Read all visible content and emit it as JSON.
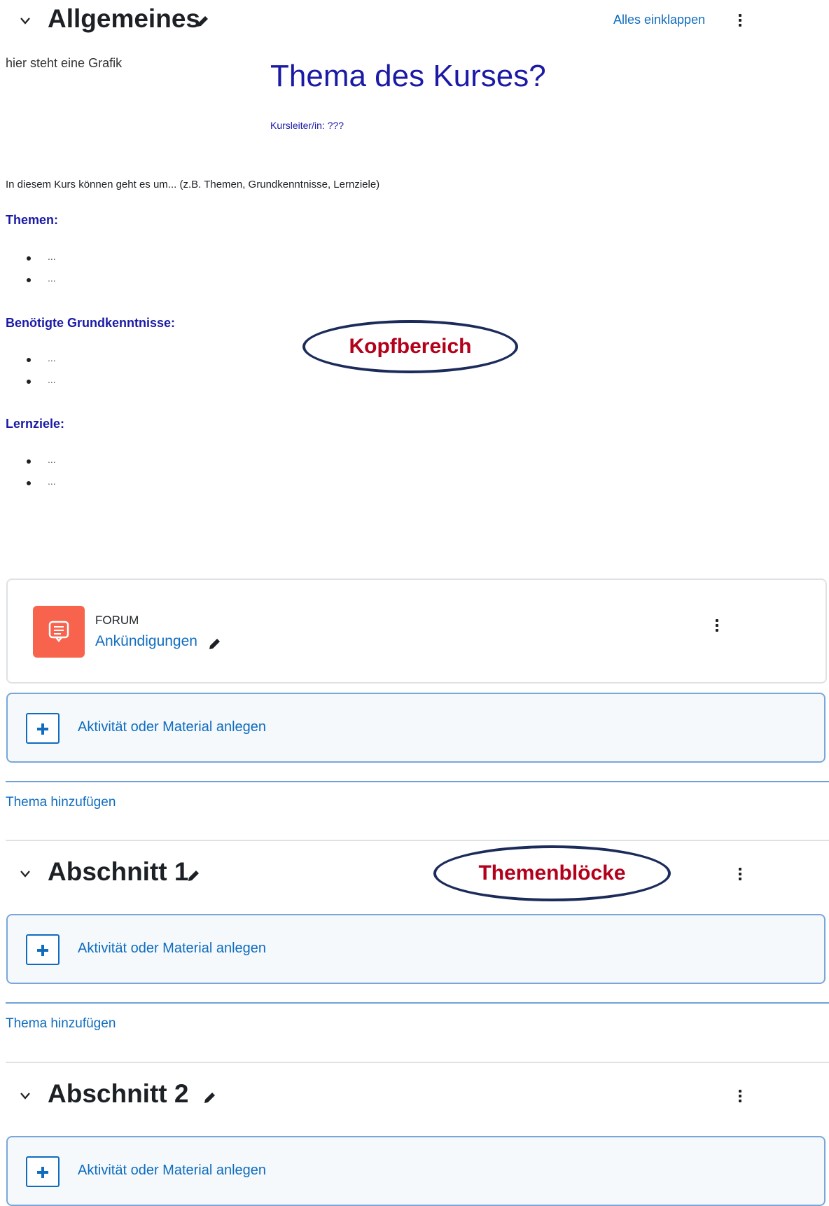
{
  "general_section": {
    "title": "Allgemeines",
    "collapse_all": "Alles einklappen",
    "graphic_placeholder": "hier steht eine Grafik",
    "course_title": "Thema des Kurses?",
    "instructor": "Kursleiter/in: ???",
    "intro": "In diesem Kurs können geht es um... (z.B. Themen, Grundkenntnisse, Lernziele)",
    "lists": [
      {
        "heading": "Themen:",
        "items": [
          "...",
          "..."
        ]
      },
      {
        "heading": "Benötigte Grundkenntnisse:",
        "items": [
          "...",
          "..."
        ]
      },
      {
        "heading": "Lernziele:",
        "items": [
          "...",
          "..."
        ]
      }
    ]
  },
  "forum": {
    "type": "FORUM",
    "name": "Ankündigungen"
  },
  "add_activity_label": "Aktivität oder Material anlegen",
  "add_topic_label": "Thema hinzufügen",
  "sections": [
    {
      "title": "Abschnitt 1"
    },
    {
      "title": "Abschnitt 2"
    }
  ],
  "annotations": {
    "header_area": "Kopfbereich",
    "topic_blocks": "Themenblöcke"
  },
  "colors": {
    "accent": "#0f6cbf",
    "forum_icon": "#f7634d",
    "heading_blue": "#1a1aa6",
    "callout_text": "#b3001b",
    "callout_border": "#1b2b5a"
  }
}
